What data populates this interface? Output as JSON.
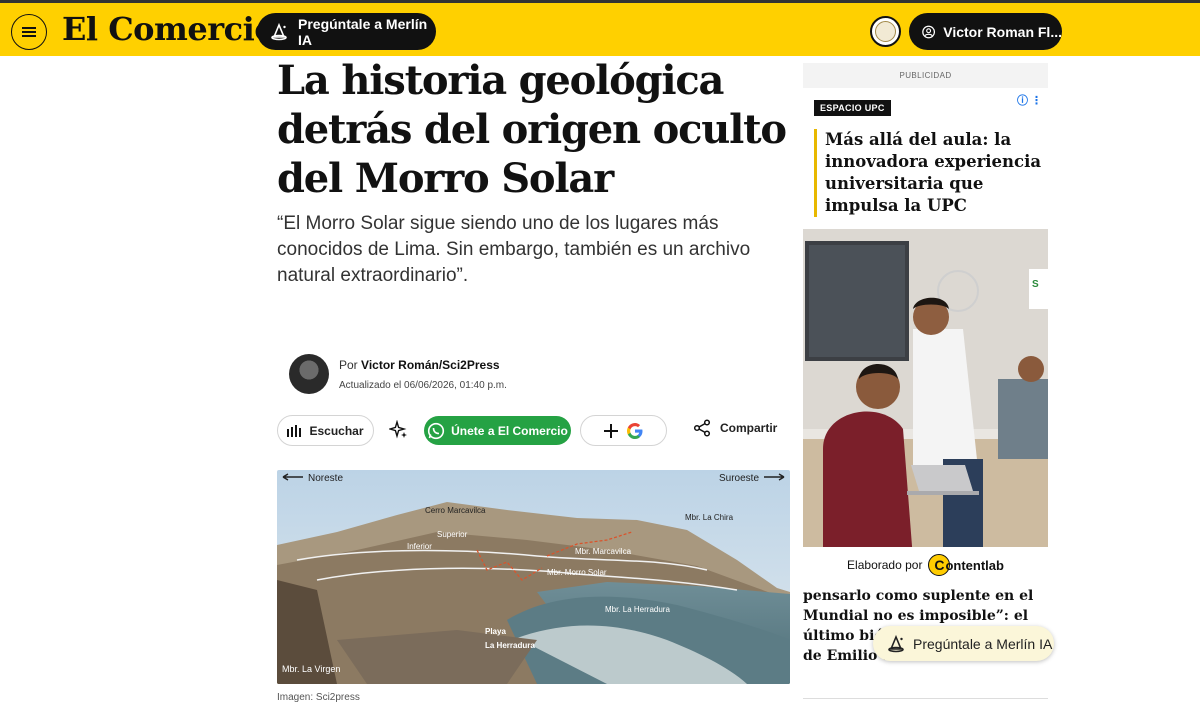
{
  "header": {
    "logo": "El Comercio",
    "merlin_label": "Pregúntale a Merlín IA",
    "user_label": "Victor Roman Fl..."
  },
  "article": {
    "headline": "La historia geológica detrás del origen oculto del Morro Solar",
    "subheadline": "“El Morro Solar sigue siendo uno de los lugares más conocidos de Lima. Sin embargo, también es un archivo natural extraordinario”.",
    "author_prefix": "Por",
    "author": "Victor Román/Sci2Press",
    "updated": "Actualizado el 06/06/2026, 01:40 p.m.",
    "actions": {
      "listen": "Escuchar",
      "whatsapp": "Únete a El Comercio",
      "share": "Compartir"
    },
    "image_labels": {
      "northeast": "Noreste",
      "southwest": "Suroeste",
      "cerro": "Cerro Marcavilca",
      "superior": "Superior",
      "inferior": "Inferior",
      "la_chira": "Mbr. La Chira",
      "marcavilca": "Mbr. Marcavilca",
      "morro_solar": "Mbr. Morro Solar",
      "herradura": "Mbr. La Herradura",
      "playa": "Playa",
      "playa2": "La Herradura",
      "la_virgen": "Mbr. La Virgen"
    },
    "image_caption": "Imagen: Sci2press"
  },
  "sidebar": {
    "ad_label": "PUBLICIDAD",
    "ad_tag": "ESPACIO UPC",
    "ad_title": "Más allá del aula: la innovadora experiencia universitaria que impulsa la UPC",
    "ad_footer_prefix": "Elaborado por",
    "ad_footer_brand": "ontentlab",
    "ad_footer_brand_c": "C",
    "related_title": "pensarlo como suplente en el Mundial no es imposible”: el último biógrafo y radiografía de Emilio ... mundo"
  },
  "floating": {
    "merlin_label": "Pregúntale a Merlín IA"
  },
  "colors": {
    "brand_yellow": "#ffd000",
    "whatsapp_green": "#25a244",
    "dark": "#111111"
  }
}
